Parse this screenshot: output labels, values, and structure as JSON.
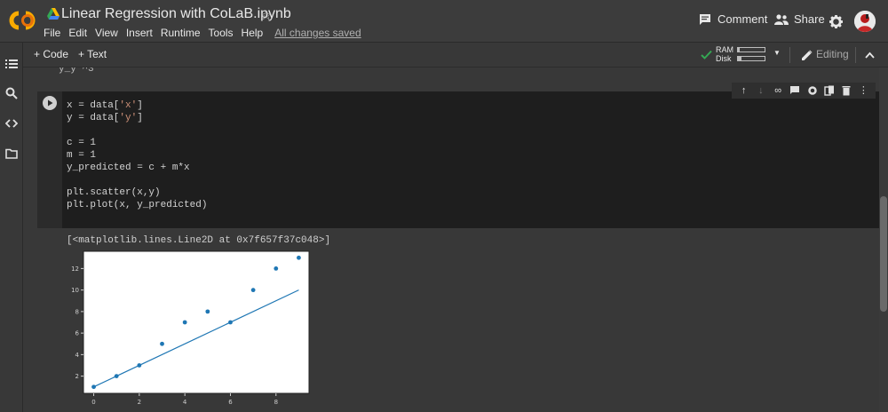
{
  "app": {
    "notebook_title": "Linear Regression with CoLaB.ipynb"
  },
  "menu": [
    "File",
    "Edit",
    "View",
    "Insert",
    "Runtime",
    "Tools",
    "Help"
  ],
  "menu_status": "All changes saved",
  "header_actions": {
    "comment": "Comment",
    "share": "Share"
  },
  "toolbar": {
    "add_code": "+ Code",
    "add_text": "+ Text",
    "ram_label": "RAM",
    "disk_label": "Disk",
    "ram_usage": 0.05,
    "disk_usage": 0.12,
    "editing": "Editing"
  },
  "cut_line": "y_y   ^3",
  "code_cell": {
    "lines": [
      "x = data['x']",
      "y = data['y']",
      "",
      "c = 1",
      "m = 1",
      "y_predicted = c + m*x",
      "",
      "plt.scatter(x,y)",
      "plt.plot(x, y_predicted)"
    ]
  },
  "output": {
    "text": "[<matplotlib.lines.Line2D at 0x7f657f37c048>]"
  },
  "chart_data": {
    "type": "scatter",
    "title": "",
    "xlabel": "",
    "ylabel": "",
    "xlim": [
      -0.45,
      9.45
    ],
    "ylim": [
      0.4,
      13.6
    ],
    "x_ticks": [
      0,
      2,
      4,
      6,
      8
    ],
    "y_ticks": [
      2,
      4,
      6,
      8,
      10,
      12
    ],
    "series": [
      {
        "kind": "scatter",
        "x": [
          0,
          1,
          2,
          3,
          4,
          5,
          6,
          7,
          8,
          9
        ],
        "y": [
          1,
          2,
          3,
          5,
          7,
          8,
          7,
          10,
          12,
          13
        ],
        "color": "#1f77b4"
      },
      {
        "kind": "line",
        "x": [
          0,
          9
        ],
        "y": [
          1,
          10
        ],
        "color": "#1f77b4"
      }
    ],
    "grid": false
  },
  "colors": {
    "accent_orange": "#f9ab00",
    "check_green": "#34a853"
  }
}
